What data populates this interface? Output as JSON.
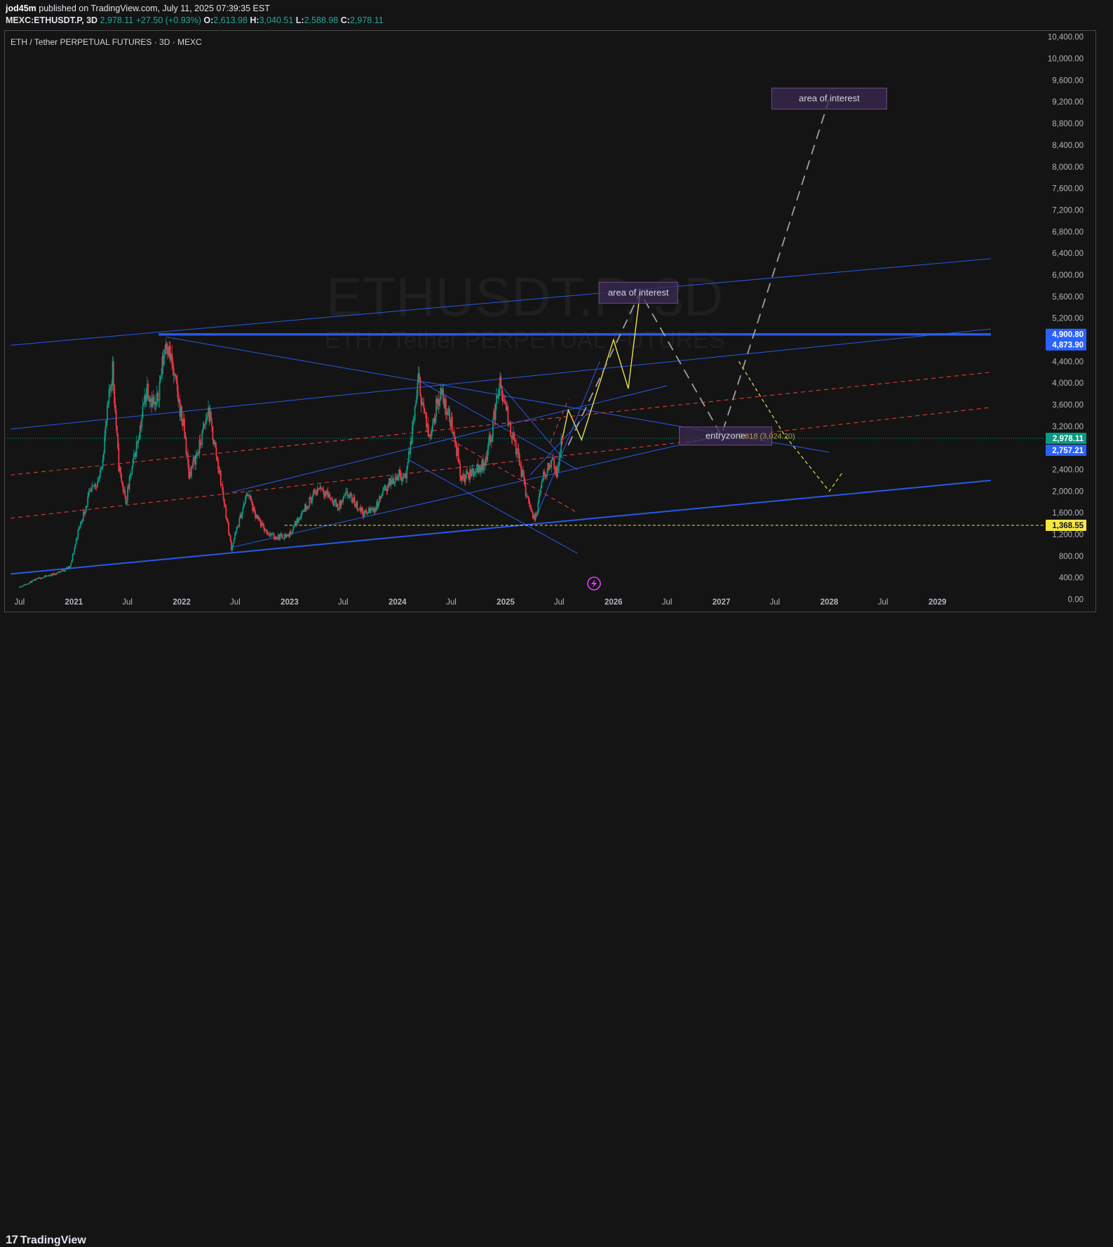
{
  "header": {
    "publisher": "jod45m",
    "published_text": "published on TradingView.com, July 11, 2025 07:39:35 EST",
    "symbol": "MEXC:ETHUSDT.P, 3D",
    "last": "2,978.11",
    "change": "+27.50 (+0.93%)",
    "open_label": "O:",
    "open": "2,613.98",
    "high_label": "H:",
    "high": "3,040.51",
    "low_label": "L:",
    "low": "2,588.98",
    "close_label": "C:",
    "close": "2,978.11"
  },
  "footer": {
    "logo_text": "TradingView",
    "logo_mark": "17"
  },
  "chart_data": {
    "type": "candlestick",
    "title": "ETH / Tether PERPETUAL FUTURES · 3D · MEXC",
    "watermark": {
      "symbol": "ETHUSDT.P, 3D",
      "description": "ETH / Tether PERPETUAL FUTURES"
    },
    "y_axis": {
      "range": [
        -200,
        10500
      ],
      "ticks": [
        "10,400.00",
        "10,000.00",
        "9,600.00",
        "9,200.00",
        "8,800.00",
        "8,400.00",
        "8,000.00",
        "7,600.00",
        "7,200.00",
        "6,800.00",
        "6,400.00",
        "6,000.00",
        "5,600.00",
        "5,200.00",
        "4,400.00",
        "4,000.00",
        "3,600.00",
        "3,200.00",
        "2,400.00",
        "2,000.00",
        "1,600.00",
        "1,200.00",
        "800.00",
        "400.00",
        "0.00"
      ],
      "tick_values": [
        10400,
        10000,
        9600,
        9200,
        8800,
        8400,
        8000,
        7600,
        7200,
        6800,
        6400,
        6000,
        5600,
        5200,
        4400,
        4000,
        3600,
        3200,
        2400,
        2000,
        1600,
        1200,
        800,
        400,
        0
      ]
    },
    "x_axis": {
      "range": [
        "2020-05-15",
        "2029-12-31"
      ],
      "ticks": [
        "Jul",
        "2021",
        "Jul",
        "2022",
        "Jul",
        "2023",
        "Jul",
        "2024",
        "Jul",
        "2025",
        "Jul",
        "2026",
        "Jul",
        "2027",
        "Jul",
        "2028",
        "Jul",
        "2029"
      ],
      "tick_dates": [
        "2020-07-01",
        "2021-01-01",
        "2021-07-01",
        "2022-01-01",
        "2022-07-01",
        "2023-01-01",
        "2023-07-01",
        "2024-01-01",
        "2024-07-01",
        "2025-01-01",
        "2025-07-01",
        "2026-01-01",
        "2026-07-01",
        "2027-01-01",
        "2027-07-01",
        "2028-01-01",
        "2028-07-01",
        "2029-01-01"
      ]
    },
    "price_labels": [
      {
        "text": "4,900.80",
        "value": 4900.8,
        "color": "#2962ff"
      },
      {
        "text": "4,873.90",
        "value": 4873.9,
        "color": "#2962ff"
      },
      {
        "text": "2,978.11",
        "value": 2978.11,
        "color": "#089981"
      },
      {
        "text": "2,757.21",
        "value": 2757.21,
        "color": "#2962ff"
      },
      {
        "text": "1,368.55",
        "value": 1368.55,
        "color": "#f5e642"
      }
    ],
    "price_path": [
      [
        "2020-07-01",
        230
      ],
      [
        "2020-09-01",
        380
      ],
      [
        "2020-11-01",
        480
      ],
      [
        "2020-12-20",
        600
      ],
      [
        "2021-01-15",
        1250
      ],
      [
        "2021-02-20",
        1900
      ],
      [
        "2021-04-01",
        2300
      ],
      [
        "2021-05-12",
        4300
      ],
      [
        "2021-06-01",
        2500
      ],
      [
        "2021-06-25",
        1800
      ],
      [
        "2021-08-10",
        3100
      ],
      [
        "2021-09-05",
        3950
      ],
      [
        "2021-10-05",
        3500
      ],
      [
        "2021-11-10",
        4850
      ],
      [
        "2021-12-10",
        4000
      ],
      [
        "2022-01-10",
        3100
      ],
      [
        "2022-01-25",
        2300
      ],
      [
        "2022-03-01",
        2800
      ],
      [
        "2022-04-01",
        3500
      ],
      [
        "2022-05-10",
        2300
      ],
      [
        "2022-06-18",
        950
      ],
      [
        "2022-08-13",
        2000
      ],
      [
        "2022-09-05",
        1550
      ],
      [
        "2022-10-10",
        1280
      ],
      [
        "2022-11-10",
        1150
      ],
      [
        "2022-12-31",
        1190
      ],
      [
        "2023-02-15",
        1650
      ],
      [
        "2023-04-15",
        2100
      ],
      [
        "2023-06-15",
        1700
      ],
      [
        "2023-07-15",
        1950
      ],
      [
        "2023-09-10",
        1580
      ],
      [
        "2023-10-20",
        1700
      ],
      [
        "2023-11-20",
        2050
      ],
      [
        "2023-12-31",
        2300
      ],
      [
        "2024-02-01",
        2300
      ],
      [
        "2024-03-12",
        4050
      ],
      [
        "2024-04-15",
        3000
      ],
      [
        "2024-05-25",
        3850
      ],
      [
        "2024-07-10",
        3100
      ],
      [
        "2024-08-05",
        2200
      ],
      [
        "2024-09-10",
        2350
      ],
      [
        "2024-10-20",
        2500
      ],
      [
        "2024-11-15",
        3100
      ],
      [
        "2024-12-10",
        4000
      ],
      [
        "2025-01-10",
        3300
      ],
      [
        "2025-02-10",
        2700
      ],
      [
        "2025-03-10",
        2000
      ],
      [
        "2025-04-09",
        1450
      ],
      [
        "2025-05-10",
        2300
      ],
      [
        "2025-06-10",
        2600
      ],
      [
        "2025-06-25",
        2300
      ],
      [
        "2025-07-11",
        2978
      ]
    ],
    "annotations": [
      {
        "text": "area of interest",
        "date": "2026-03-26",
        "value": 5670
      },
      {
        "text": "area of interest",
        "date": "2028-01-01",
        "value": 9260
      },
      {
        "text": "entryzone",
        "date": "2027-01-15",
        "value": 3020
      },
      {
        "text": "0.618 (3,024.20)",
        "date": "2027-08-01",
        "value": 3024.2
      }
    ],
    "trendlines": [
      {
        "from": [
          "2020-06-01",
          470
        ],
        "to": [
          "2029-07-01",
          2200
        ],
        "color": "#2962ff",
        "width": 2
      },
      {
        "from": [
          "2020-06-01",
          4700
        ],
        "to": [
          "2029-07-01",
          6300
        ],
        "color": "#2962ff",
        "width": 1
      },
      {
        "from": [
          "2020-06-01",
          3150
        ],
        "to": [
          "2029-07-01",
          5000
        ],
        "color": "#2962ff",
        "width": 1
      },
      {
        "from": [
          "2021-10-15",
          4900
        ],
        "to": [
          "2029-07-01",
          4900
        ],
        "color": "#2962ff",
        "width": 3.5
      },
      {
        "from": [
          "2021-11-10",
          4850
        ],
        "to": [
          "2028-01-01",
          2720
        ],
        "color": "#2962ff",
        "width": 1
      },
      {
        "from": [
          "2022-06-18",
          960
        ],
        "to": [
          "2027-01-15",
          3050
        ],
        "color": "#2962ff",
        "width": 1
      },
      {
        "from": [
          "2022-06-18",
          1980
        ],
        "to": [
          "2026-07-01",
          3950
        ],
        "color": "#2962ff",
        "width": 1
      },
      {
        "from": [
          "2024-03-12",
          4050
        ],
        "to": [
          "2025-09-01",
          2400
        ],
        "color": "#2962ff",
        "width": 1
      },
      {
        "from": [
          "2024-02-01",
          2600
        ],
        "to": [
          "2025-09-01",
          850
        ],
        "color": "#2962ff",
        "width": 1
      },
      {
        "from": [
          "2025-04-09",
          1450
        ],
        "to": [
          "2025-11-15",
          4400
        ],
        "color": "#2962ff",
        "width": 1
      },
      {
        "from": [
          "2025-03-25",
          2300
        ],
        "to": [
          "2025-10-15",
          3500
        ],
        "color": "#2962ff",
        "width": 1
      },
      {
        "from": [
          "2024-12-10",
          4000
        ],
        "to": [
          "2025-07-15",
          2600
        ],
        "color": "#2962ff",
        "width": 1
      }
    ],
    "red_dashed": [
      {
        "from": [
          "2020-06-01",
          2300
        ],
        "to": [
          "2029-07-01",
          4200
        ]
      },
      {
        "from": [
          "2020-06-01",
          1500
        ],
        "to": [
          "2029-07-01",
          3550
        ]
      },
      {
        "from": [
          "2024-07-01",
          2950
        ],
        "to": [
          "2025-09-01",
          1600
        ]
      },
      {
        "from": [
          "2025-06-01",
          2900
        ],
        "to": [
          "2025-08-01",
          3700
        ]
      }
    ],
    "yellow_level": {
      "from": [
        "2022-12-15",
        1368.55
      ],
      "to": [
        "2029-12-31",
        1368.55
      ]
    },
    "yellow_projection": [
      [
        "2025-07-11",
        2950
      ],
      [
        "2025-08-01",
        3500
      ],
      [
        "2025-09-15",
        2950
      ],
      [
        "2026-01-01",
        4800
      ],
      [
        "2026-02-20",
        3900
      ],
      [
        "2026-04-01",
        5680
      ]
    ],
    "yellow_dashed_projection": [
      [
        "2027-03-01",
        4400
      ],
      [
        "2027-08-01",
        3050
      ],
      [
        "2028-01-01",
        2000
      ],
      [
        "2028-02-15",
        2350
      ]
    ],
    "gray_dashed_projection": [
      [
        "2025-08-01",
        2850
      ],
      [
        "2026-04-01",
        5680
      ],
      [
        "2027-01-01",
        3030
      ],
      [
        "2028-01-01",
        9250
      ]
    ]
  }
}
